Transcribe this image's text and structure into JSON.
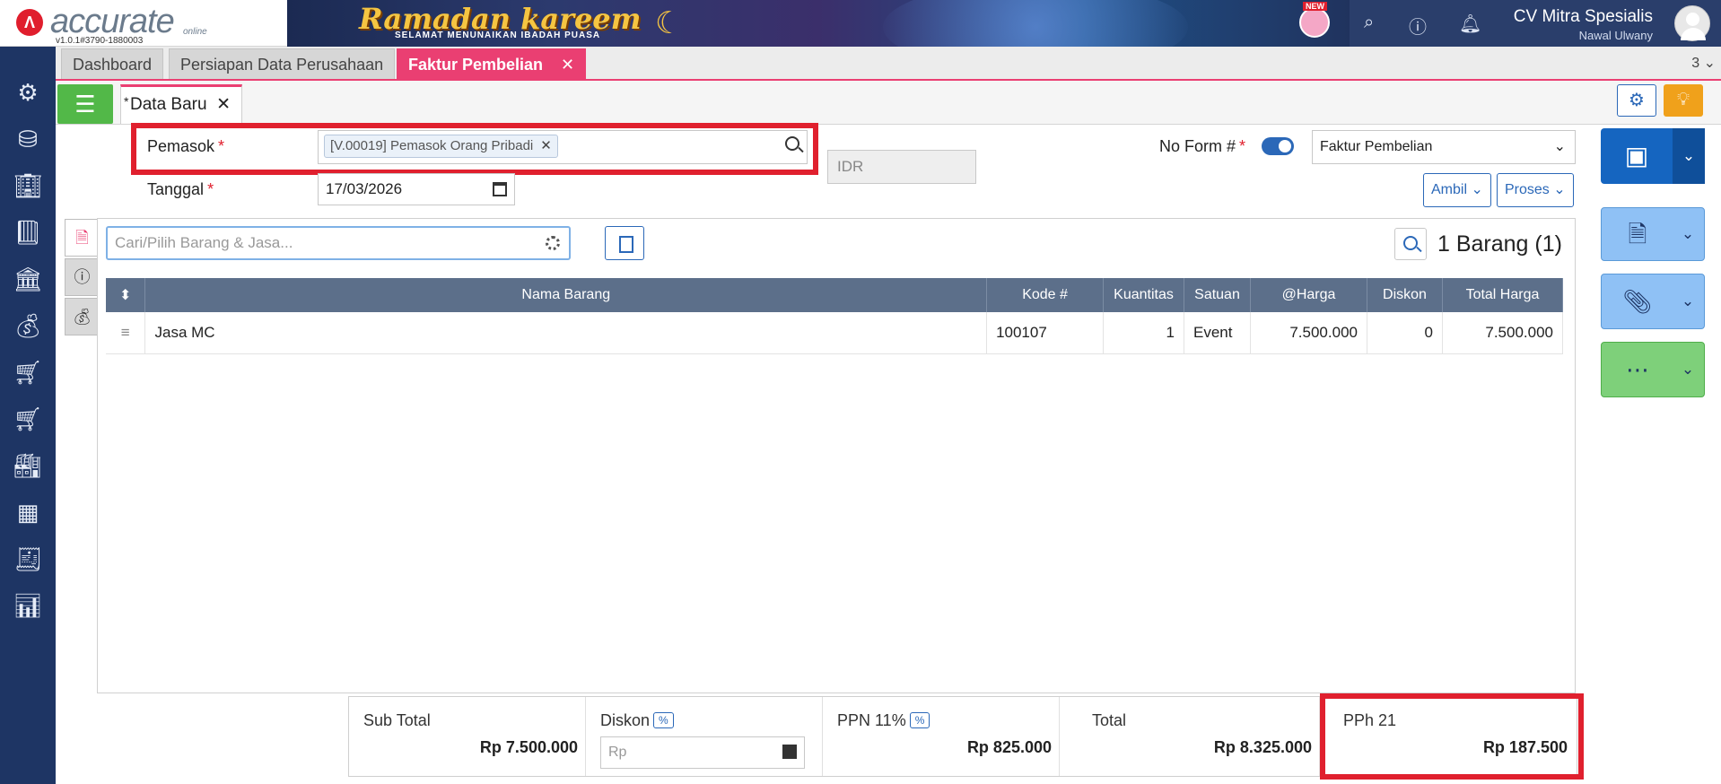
{
  "app": {
    "logo_text": "accurate",
    "logo_sub": "online",
    "version": "v1.0.1#3790-1880003"
  },
  "banner": {
    "title": "Ramadan kareem",
    "subtitle": "SELAMAT MENUNAIKAN IBADAH PUASA",
    "new_label": "NEW"
  },
  "header": {
    "company": "CV Mitra Spesialis",
    "user": "Nawal Ulwany"
  },
  "tabs": [
    {
      "label": "Dashboard"
    },
    {
      "label": "Persiapan Data Perusahaan"
    },
    {
      "label": "Faktur Pembelian",
      "active": true
    }
  ],
  "tab_count": "3",
  "subtab": {
    "label": "Data Baru",
    "modified": "*"
  },
  "form": {
    "supplier_label": "Pemasok",
    "required_mark": "*",
    "supplier_value": "[V.00019] Pemasok Orang Pribadi",
    "currency": "IDR",
    "form_no_label": "No Form #",
    "form_type": "Faktur Pembelian",
    "date_label": "Tanggal",
    "date_value": "17/03/2026",
    "ambil_label": "Ambil",
    "proses_label": "Proses"
  },
  "items": {
    "search_placeholder": "Cari/Pilih Barang & Jasa...",
    "count_label": "1 Barang (1)",
    "columns": [
      "Nama Barang",
      "Kode #",
      "Kuantitas",
      "Satuan",
      "@Harga",
      "Diskon",
      "Total Harga"
    ],
    "rows": [
      {
        "name": "Jasa MC",
        "code": "100107",
        "qty": "1",
        "unit": "Event",
        "price": "7.500.000",
        "discount": "0",
        "total": "7.500.000"
      }
    ]
  },
  "totals": {
    "subtotal_label": "Sub Total",
    "subtotal_value": "Rp 7.500.000",
    "discount_label": "Diskon",
    "discount_prefix": "Rp",
    "percent_symbol": "%",
    "ppn_label": "PPN 11%",
    "ppn_value": "Rp 825.000",
    "total_label": "Total",
    "total_value": "Rp 8.325.000",
    "pph_label": "PPh 21",
    "pph_value": "Rp 187.500"
  },
  "colors": {
    "accent_pink": "#ea3f72",
    "brand_blue": "#1e3564",
    "highlight_red": "#e0202e",
    "save_blue": "#1565c0"
  }
}
